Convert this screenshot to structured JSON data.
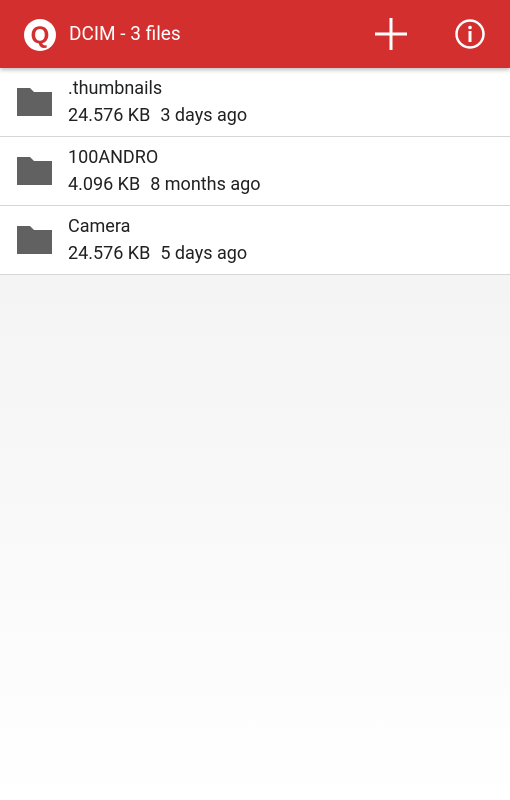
{
  "app_bar": {
    "logo_letter": "Q",
    "title": "DCIM - 3 files",
    "add_icon": "plus-icon",
    "info_icon": "info-icon",
    "color": "#d32f2f"
  },
  "files": [
    {
      "name": ".thumbnails",
      "size": "24.576 KB",
      "modified": "3 days ago",
      "icon": "folder-icon"
    },
    {
      "name": "100ANDRO",
      "size": "4.096 KB",
      "modified": "8 months ago",
      "icon": "folder-icon"
    },
    {
      "name": "Camera",
      "size": "24.576 KB",
      "modified": "5 days ago",
      "icon": "folder-icon"
    }
  ]
}
